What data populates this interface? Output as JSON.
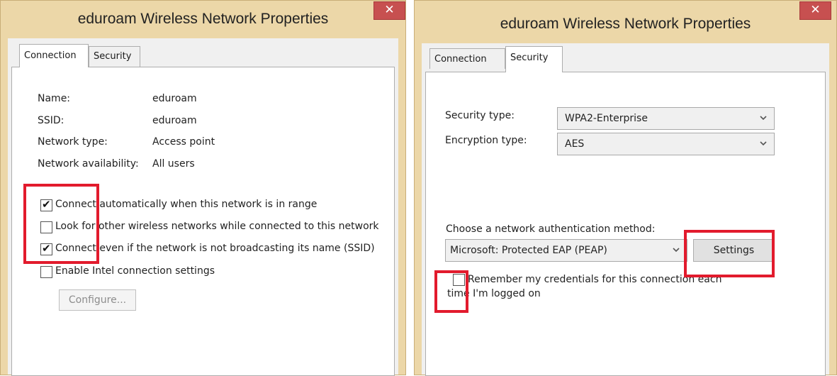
{
  "left_dialog": {
    "title": "eduroam Wireless Network Properties",
    "close_glyph": "✕",
    "tabs": [
      {
        "label": "Connection",
        "active": true
      },
      {
        "label": "Security",
        "active": false
      }
    ],
    "info": [
      {
        "label": "Name:",
        "value": "eduroam"
      },
      {
        "label": "SSID:",
        "value": "eduroam"
      },
      {
        "label": "Network type:",
        "value": "Access point"
      },
      {
        "label": "Network availability:",
        "value": "All users"
      }
    ],
    "checkboxes": [
      {
        "label": "Connect automatically when this network is in range",
        "checked": true
      },
      {
        "label": "Look for other wireless networks while connected to this network",
        "checked": false
      },
      {
        "label": "Connect even if the network is not broadcasting its name (SSID)",
        "checked": true
      },
      {
        "label": "Enable Intel connection settings",
        "checked": false
      }
    ],
    "configure_button": "Configure..."
  },
  "right_dialog": {
    "title": "eduroam Wireless Network Properties",
    "close_glyph": "✕",
    "tabs": [
      {
        "label": "Connection",
        "active": false
      },
      {
        "label": "Security",
        "active": true
      }
    ],
    "security_type_label": "Security type:",
    "security_type_value": "WPA2-Enterprise",
    "encryption_type_label": "Encryption type:",
    "encryption_type_value": "AES",
    "auth_method_label": "Choose a network authentication method:",
    "auth_method_value": "Microsoft: Protected EAP (PEAP)",
    "settings_button": "Settings",
    "remember_line1": "Remember my credentials for this connection each",
    "remember_line2": "time I'm logged on",
    "remember_checked": false
  },
  "colors": {
    "titlebar_bg": "#ecd7a8",
    "close_button": "#c75050",
    "highlight_box": "#e21b2d",
    "client_bg": "#f0f0f0"
  },
  "icons": {
    "close": "close-icon",
    "dropdown": "chevron-down-icon",
    "check": "checkmark-icon"
  }
}
